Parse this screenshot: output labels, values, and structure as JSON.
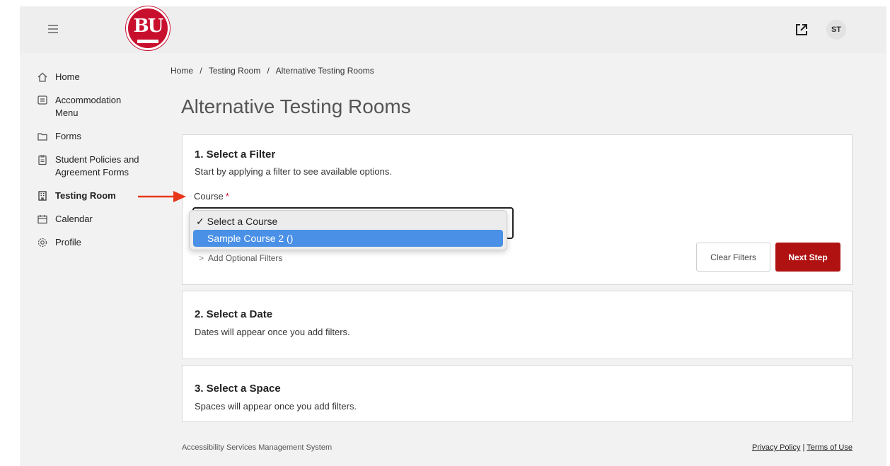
{
  "header": {
    "logo_text": "BU",
    "avatar_initials": "ST"
  },
  "sidebar": {
    "items": [
      {
        "label": "Home",
        "icon": "home-icon"
      },
      {
        "label": "Accommodation Menu",
        "icon": "list-icon"
      },
      {
        "label": "Forms",
        "icon": "folder-icon"
      },
      {
        "label": "Student Policies and Agreement Forms",
        "icon": "clipboard-icon"
      },
      {
        "label": "Testing Room",
        "icon": "building-icon",
        "active": true
      },
      {
        "label": "Calendar",
        "icon": "calendar-icon"
      },
      {
        "label": "Profile",
        "icon": "gear-icon"
      }
    ]
  },
  "breadcrumb": {
    "items": [
      "Home",
      "Testing Room",
      "Alternative Testing Rooms"
    ],
    "separator": "/"
  },
  "page": {
    "title": "Alternative Testing Rooms"
  },
  "step1": {
    "title": "1. Select a Filter",
    "description": "Start by applying a filter to see available options.",
    "course_label": "Course",
    "required_mark": "*",
    "dropdown_options": [
      "✓ Select a Course",
      "Sample Course 2 ()"
    ],
    "optional_filters_label": "Add Optional Filters",
    "clear_button": "Clear Filters",
    "next_button": "Next Step"
  },
  "step2": {
    "title": "2. Select a Date",
    "description": "Dates will appear once you add filters."
  },
  "step3": {
    "title": "3. Select a Space",
    "description": "Spaces will appear once you add filters."
  },
  "footer": {
    "system_name": "Accessibility Services Management System",
    "privacy": "Privacy Policy",
    "divider": "|",
    "terms": "Terms of Use"
  },
  "colors": {
    "brand_red": "#c8102e",
    "next_button": "#b01212",
    "highlight": "#4a90e6",
    "arrow": "#e8361b"
  }
}
